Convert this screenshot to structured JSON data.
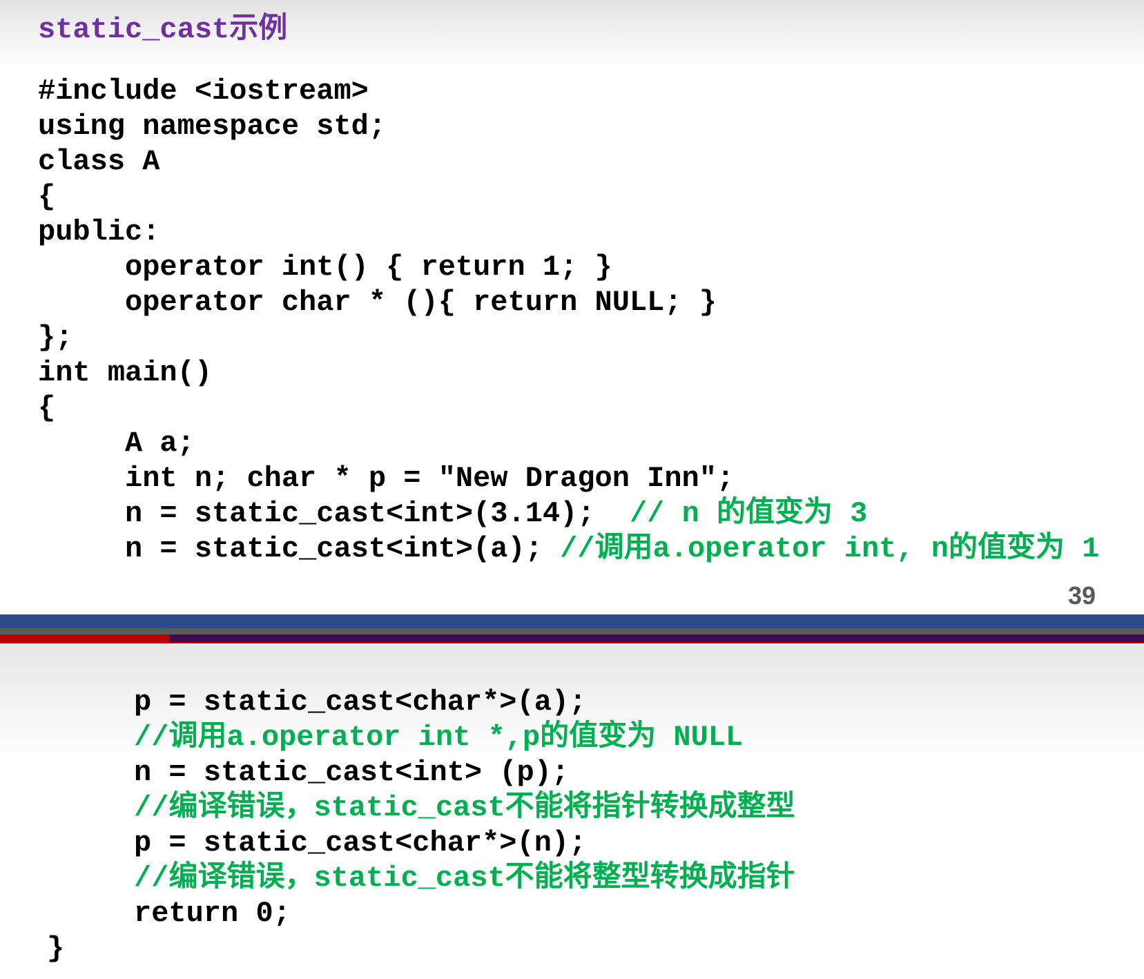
{
  "slide1": {
    "title": "static_cast示例",
    "page_number": "39",
    "code_lines": [
      {
        "code": "#include <iostream>",
        "comment": ""
      },
      {
        "code": "using namespace std;",
        "comment": ""
      },
      {
        "code": "class A",
        "comment": ""
      },
      {
        "code": "{",
        "comment": ""
      },
      {
        "code": "public:",
        "comment": ""
      },
      {
        "code": "     operator int() { return 1; }",
        "comment": ""
      },
      {
        "code": "     operator char * (){ return NULL; }",
        "comment": ""
      },
      {
        "code": "};",
        "comment": ""
      },
      {
        "code": "int main()",
        "comment": ""
      },
      {
        "code": "{",
        "comment": ""
      },
      {
        "code": "     A a;",
        "comment": ""
      },
      {
        "code": "     int n; char * p = \"New Dragon Inn\";",
        "comment": ""
      },
      {
        "code": "     n = static_cast<int>(3.14);  ",
        "comment": "// n 的值变为 3"
      },
      {
        "code": "     n = static_cast<int>(a); ",
        "comment": "//调用a.operator int, n的值变为 1"
      }
    ]
  },
  "slide2": {
    "code_lines": [
      {
        "code": "     p = static_cast<char*>(a);",
        "comment": ""
      },
      {
        "code": "     ",
        "comment": "//调用a.operator int *,p的值变为 NULL"
      },
      {
        "code": "     n = static_cast<int> (p);",
        "comment": ""
      },
      {
        "code": "     ",
        "comment": "//编译错误，static_cast不能将指针转换成整型"
      },
      {
        "code": "     p = static_cast<char*>(n);",
        "comment": ""
      },
      {
        "code": "     ",
        "comment": "//编译错误，static_cast不能将整型转换成指针"
      },
      {
        "code": "     return 0;",
        "comment": ""
      },
      {
        "code": "}",
        "comment": ""
      }
    ]
  },
  "colors": {
    "title": "#7030a0",
    "code": "#000000",
    "comment": "#00b050",
    "separator_blue": "#2d4b86",
    "separator_red": "#c00000",
    "separator_purple": "#3d0a52"
  }
}
